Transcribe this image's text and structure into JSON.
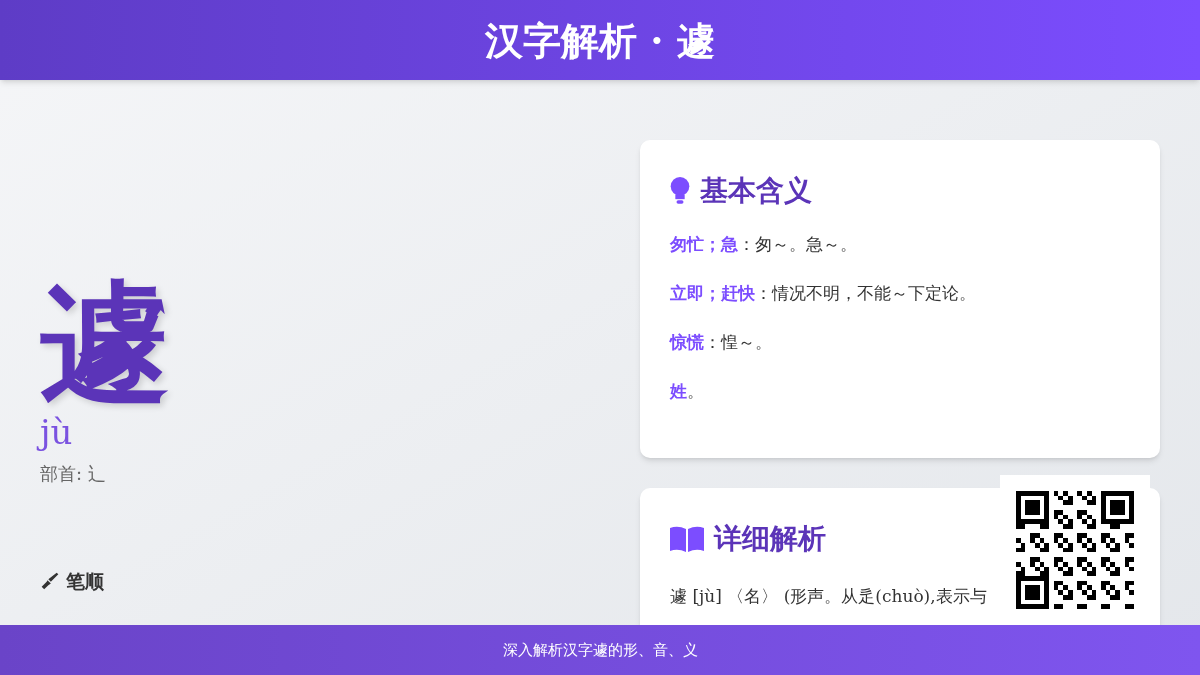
{
  "header": {
    "title": "汉字解析 · 遽"
  },
  "character": {
    "glyph": "遽",
    "pinyin": "jù",
    "radical": "部首: 辶"
  },
  "stroke_section": {
    "title": "笔顺"
  },
  "basic_meanings": {
    "title": "基本含义",
    "items": [
      {
        "term": "匆忙；急",
        "text": "：匆～。急～。"
      },
      {
        "term": "立即；赶快",
        "text": "：情况不明，不能～下定论。"
      },
      {
        "term": "惊慌",
        "text": "：惶～。"
      },
      {
        "term": "姓",
        "text": "。"
      }
    ]
  },
  "detailed": {
    "title": "详细解析",
    "text": "遽 [jù] 〈名〉 (形声。从辵(chuò),表示与"
  },
  "footer": {
    "text": "深入解析汉字遽的形、音、义"
  }
}
